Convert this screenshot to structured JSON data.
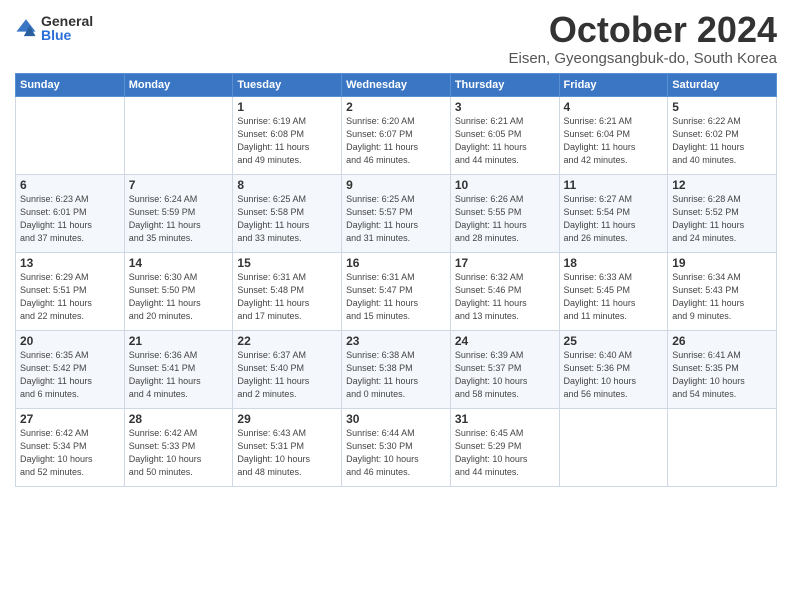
{
  "logo": {
    "general": "General",
    "blue": "Blue"
  },
  "title": "October 2024",
  "subtitle": "Eisen, Gyeongsangbuk-do, South Korea",
  "days_of_week": [
    "Sunday",
    "Monday",
    "Tuesday",
    "Wednesday",
    "Thursday",
    "Friday",
    "Saturday"
  ],
  "weeks": [
    [
      {
        "day": "",
        "info": ""
      },
      {
        "day": "",
        "info": ""
      },
      {
        "day": "1",
        "info": "Sunrise: 6:19 AM\nSunset: 6:08 PM\nDaylight: 11 hours\nand 49 minutes."
      },
      {
        "day": "2",
        "info": "Sunrise: 6:20 AM\nSunset: 6:07 PM\nDaylight: 11 hours\nand 46 minutes."
      },
      {
        "day": "3",
        "info": "Sunrise: 6:21 AM\nSunset: 6:05 PM\nDaylight: 11 hours\nand 44 minutes."
      },
      {
        "day": "4",
        "info": "Sunrise: 6:21 AM\nSunset: 6:04 PM\nDaylight: 11 hours\nand 42 minutes."
      },
      {
        "day": "5",
        "info": "Sunrise: 6:22 AM\nSunset: 6:02 PM\nDaylight: 11 hours\nand 40 minutes."
      }
    ],
    [
      {
        "day": "6",
        "info": "Sunrise: 6:23 AM\nSunset: 6:01 PM\nDaylight: 11 hours\nand 37 minutes."
      },
      {
        "day": "7",
        "info": "Sunrise: 6:24 AM\nSunset: 5:59 PM\nDaylight: 11 hours\nand 35 minutes."
      },
      {
        "day": "8",
        "info": "Sunrise: 6:25 AM\nSunset: 5:58 PM\nDaylight: 11 hours\nand 33 minutes."
      },
      {
        "day": "9",
        "info": "Sunrise: 6:25 AM\nSunset: 5:57 PM\nDaylight: 11 hours\nand 31 minutes."
      },
      {
        "day": "10",
        "info": "Sunrise: 6:26 AM\nSunset: 5:55 PM\nDaylight: 11 hours\nand 28 minutes."
      },
      {
        "day": "11",
        "info": "Sunrise: 6:27 AM\nSunset: 5:54 PM\nDaylight: 11 hours\nand 26 minutes."
      },
      {
        "day": "12",
        "info": "Sunrise: 6:28 AM\nSunset: 5:52 PM\nDaylight: 11 hours\nand 24 minutes."
      }
    ],
    [
      {
        "day": "13",
        "info": "Sunrise: 6:29 AM\nSunset: 5:51 PM\nDaylight: 11 hours\nand 22 minutes."
      },
      {
        "day": "14",
        "info": "Sunrise: 6:30 AM\nSunset: 5:50 PM\nDaylight: 11 hours\nand 20 minutes."
      },
      {
        "day": "15",
        "info": "Sunrise: 6:31 AM\nSunset: 5:48 PM\nDaylight: 11 hours\nand 17 minutes."
      },
      {
        "day": "16",
        "info": "Sunrise: 6:31 AM\nSunset: 5:47 PM\nDaylight: 11 hours\nand 15 minutes."
      },
      {
        "day": "17",
        "info": "Sunrise: 6:32 AM\nSunset: 5:46 PM\nDaylight: 11 hours\nand 13 minutes."
      },
      {
        "day": "18",
        "info": "Sunrise: 6:33 AM\nSunset: 5:45 PM\nDaylight: 11 hours\nand 11 minutes."
      },
      {
        "day": "19",
        "info": "Sunrise: 6:34 AM\nSunset: 5:43 PM\nDaylight: 11 hours\nand 9 minutes."
      }
    ],
    [
      {
        "day": "20",
        "info": "Sunrise: 6:35 AM\nSunset: 5:42 PM\nDaylight: 11 hours\nand 6 minutes."
      },
      {
        "day": "21",
        "info": "Sunrise: 6:36 AM\nSunset: 5:41 PM\nDaylight: 11 hours\nand 4 minutes."
      },
      {
        "day": "22",
        "info": "Sunrise: 6:37 AM\nSunset: 5:40 PM\nDaylight: 11 hours\nand 2 minutes."
      },
      {
        "day": "23",
        "info": "Sunrise: 6:38 AM\nSunset: 5:38 PM\nDaylight: 11 hours\nand 0 minutes."
      },
      {
        "day": "24",
        "info": "Sunrise: 6:39 AM\nSunset: 5:37 PM\nDaylight: 10 hours\nand 58 minutes."
      },
      {
        "day": "25",
        "info": "Sunrise: 6:40 AM\nSunset: 5:36 PM\nDaylight: 10 hours\nand 56 minutes."
      },
      {
        "day": "26",
        "info": "Sunrise: 6:41 AM\nSunset: 5:35 PM\nDaylight: 10 hours\nand 54 minutes."
      }
    ],
    [
      {
        "day": "27",
        "info": "Sunrise: 6:42 AM\nSunset: 5:34 PM\nDaylight: 10 hours\nand 52 minutes."
      },
      {
        "day": "28",
        "info": "Sunrise: 6:42 AM\nSunset: 5:33 PM\nDaylight: 10 hours\nand 50 minutes."
      },
      {
        "day": "29",
        "info": "Sunrise: 6:43 AM\nSunset: 5:31 PM\nDaylight: 10 hours\nand 48 minutes."
      },
      {
        "day": "30",
        "info": "Sunrise: 6:44 AM\nSunset: 5:30 PM\nDaylight: 10 hours\nand 46 minutes."
      },
      {
        "day": "31",
        "info": "Sunrise: 6:45 AM\nSunset: 5:29 PM\nDaylight: 10 hours\nand 44 minutes."
      },
      {
        "day": "",
        "info": ""
      },
      {
        "day": "",
        "info": ""
      }
    ]
  ]
}
